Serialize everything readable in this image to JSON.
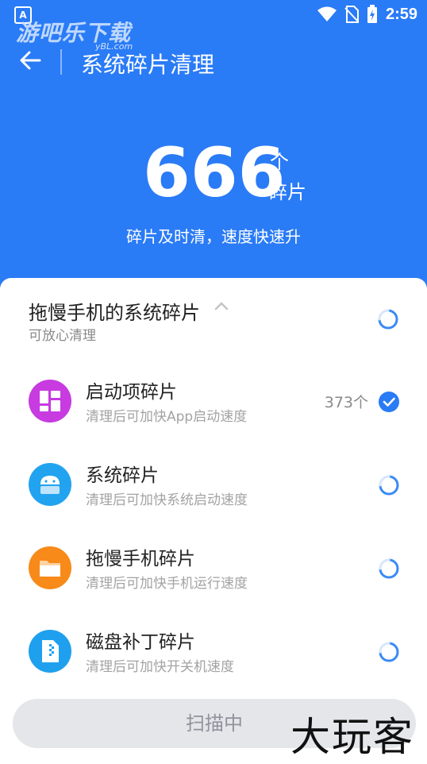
{
  "status_bar": {
    "time": "2:59",
    "app_badge": "A"
  },
  "watermark": {
    "text": "游吧乐下载",
    "sub": "yBL.com"
  },
  "header": {
    "title": "系统碎片清理"
  },
  "summary": {
    "count": "666",
    "unit": "个",
    "label": "碎片",
    "subtitle": "碎片及时清，速度快速升"
  },
  "group": {
    "title": "拖慢手机的系统碎片",
    "subtitle": "可放心清理"
  },
  "items": [
    {
      "title": "启动项碎片",
      "subtitle": "清理后可加快App启动速度",
      "count": "373个",
      "status": "checked",
      "icon": "grid-icon",
      "color": "#c73be0"
    },
    {
      "title": "系统碎片",
      "subtitle": "清理后可加快系统启动速度",
      "count": "",
      "status": "loading",
      "icon": "android-icon",
      "color": "#22a3f0"
    },
    {
      "title": "拖慢手机碎片",
      "subtitle": "清理后可加快手机运行速度",
      "count": "",
      "status": "loading",
      "icon": "folder-icon",
      "color": "#f88a1a"
    },
    {
      "title": "磁盘补丁碎片",
      "subtitle": "清理后可加快开关机速度",
      "count": "",
      "status": "loading",
      "icon": "zip-file-icon",
      "color": "#1ea0ee"
    }
  ],
  "scan_button": {
    "label": "扫描中"
  },
  "brand": {
    "text": "大玩客"
  },
  "colors": {
    "primary": "#2a7bf6",
    "check": "#2a7bf6"
  }
}
